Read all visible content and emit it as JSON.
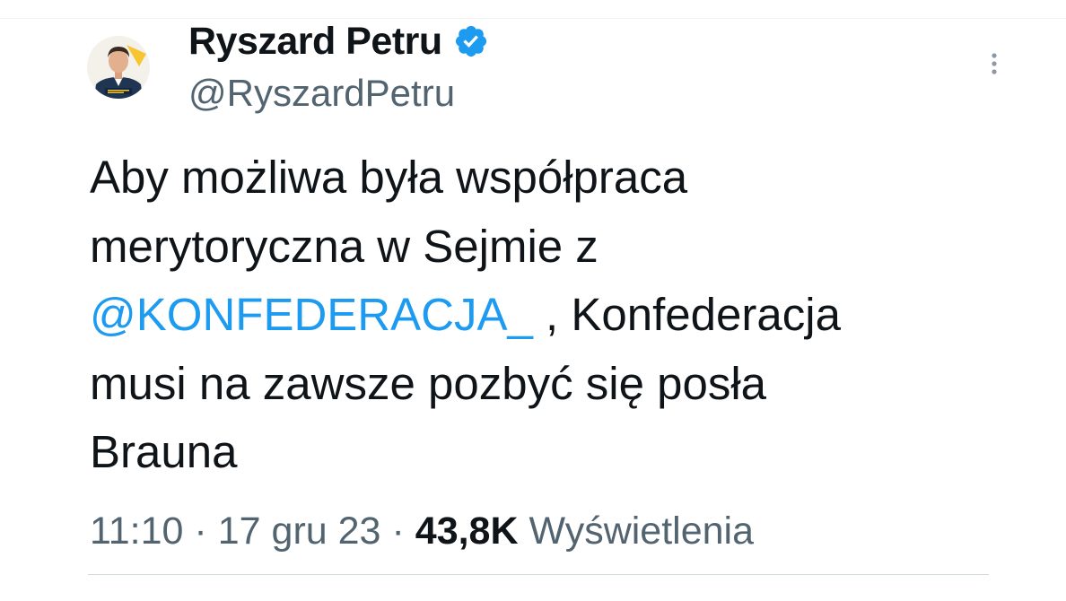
{
  "author": {
    "name": "Ryszard Petru",
    "handle": "@RyszardPetru",
    "verified": true,
    "avatar_icon": "profile-photo",
    "verified_icon": "verified-badge-icon",
    "verified_color": "#1d9bf0"
  },
  "menu": {
    "icon": "more-vertical-icon"
  },
  "tweet": {
    "lines": [
      {
        "text": "Aby możliwa była współpraca"
      },
      {
        "text": "merytoryczna w Sejmie z"
      },
      {
        "mention": "@KONFEDERACJA_",
        "text": " , Konfederacja"
      },
      {
        "text": "musi na zawsze pozbyć się posła"
      },
      {
        "text": "Brauna"
      }
    ]
  },
  "meta": {
    "time": "11:10",
    "separator": "·",
    "date": "17 gru 23",
    "views_count": "43,8K",
    "views_label": "Wyświetlenia"
  },
  "colors": {
    "link": "#1d9bf0",
    "text": "#0f1419",
    "secondary": "#536471"
  }
}
